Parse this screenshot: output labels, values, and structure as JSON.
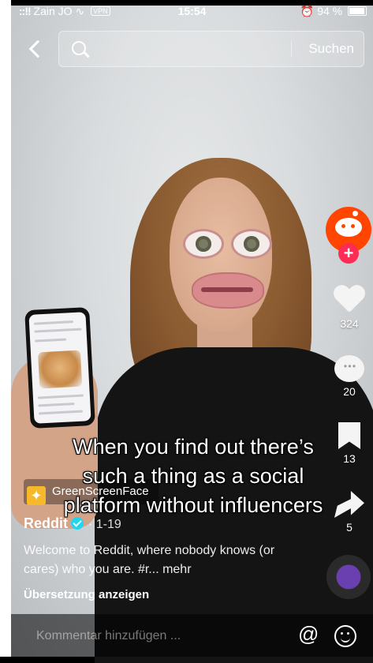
{
  "status_bar": {
    "signal": "::!!",
    "carrier": "Zain JO",
    "vpn": "VPN",
    "time": "15:54",
    "battery": "94 %"
  },
  "search": {
    "placeholder": "",
    "button_label": "Suchen"
  },
  "actions": {
    "likes": "324",
    "comments": "20",
    "bookmarks": "13",
    "shares": "5",
    "follow_symbol": "+"
  },
  "caption_overlay": "When you find out there’s such a thing as a social platform without influencers",
  "effect": {
    "label": "GreenScreenFace"
  },
  "post": {
    "author": "Reddit",
    "date": "· 1-19",
    "description": "Welcome to Reddit, where nobody knows (or cares) who you are. #r... mehr",
    "translate_label": "Übersetzung anzeigen"
  },
  "comment": {
    "placeholder": "Kommentar hinzufügen ...",
    "mention_symbol": "@"
  },
  "colors": {
    "reddit_orange": "#ff4500",
    "follow_red": "#fe2c55",
    "verified_cyan": "#20d5ec"
  },
  "icons": [
    "back-chevron-icon",
    "search-icon",
    "reddit-avatar",
    "plus-icon",
    "heart-icon",
    "comment-icon",
    "bookmark-icon",
    "share-icon",
    "music-disc-icon",
    "at-icon",
    "emoji-icon"
  ]
}
